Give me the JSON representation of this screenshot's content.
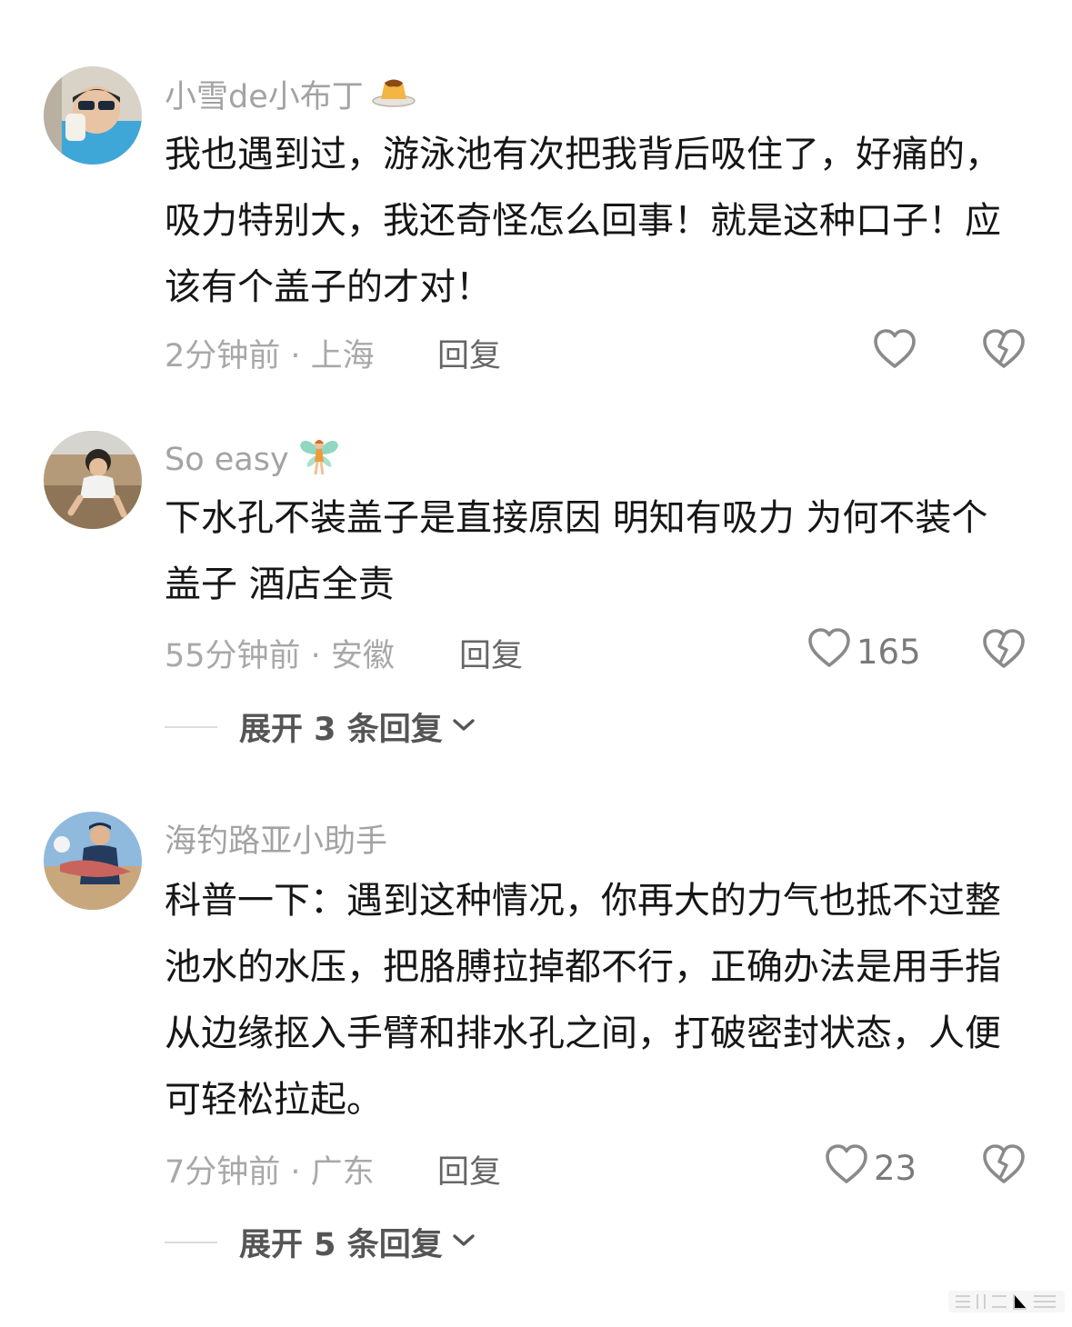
{
  "comments": [
    {
      "username": "小雪de小布丁",
      "username_emoji": "pudding-icon",
      "text": "我也遇到过，游泳池有次把我背后吸住了，好痛的，吸力特别大，我还奇怪怎么回事！就是这种口子！应该有个盖子的才对！",
      "time_location": "2分钟前 · 上海",
      "reply_label": "回复",
      "likes": ""
    },
    {
      "username": "So easy",
      "username_emoji": "fairy-icon",
      "text": "下水孔不装盖子是直接原因  明知有吸力  为何不装个盖子  酒店全责",
      "time_location": "55分钟前 · 安徽",
      "reply_label": "回复",
      "likes": "165",
      "expand_label": "展开 3 条回复"
    },
    {
      "username": "海钓路亚小助手",
      "text": "科普一下：遇到这种情况，你再大的力气也抵不过整池水的水压，把胳膊拉掉都不行，正确办法是用手指从边缘抠入手臂和排水孔之间，打破密封状态，人便可轻松拉起。",
      "time_location": "7分钟前 · 广东",
      "reply_label": "回复",
      "likes": "23",
      "expand_label": "展开 5 条回复"
    }
  ],
  "colors": {
    "username": "#a3a3a3",
    "body": "#161616",
    "meta": "#a8a8a8",
    "action": "#666666"
  }
}
